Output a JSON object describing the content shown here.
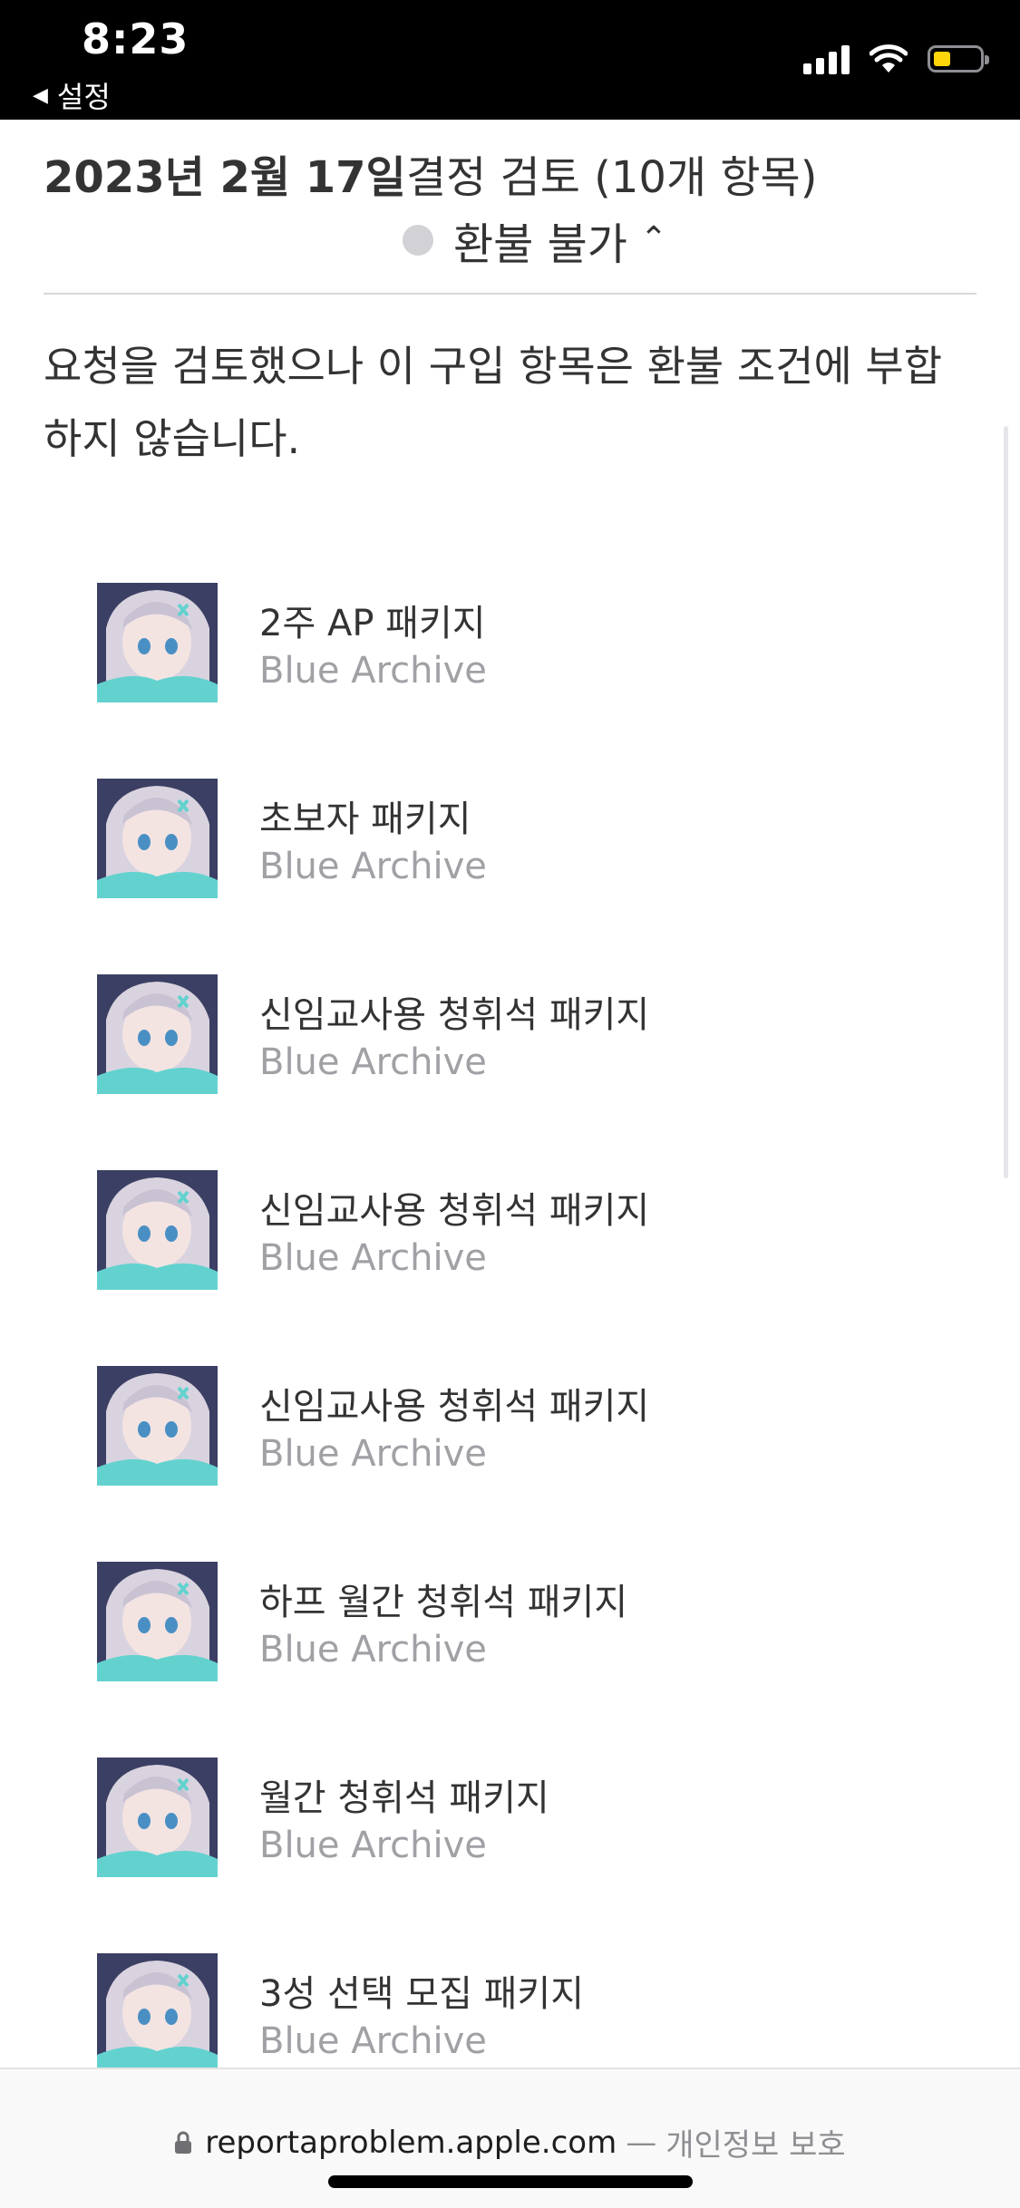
{
  "status_bar": {
    "time": "8:23",
    "back_label": "설정"
  },
  "header": {
    "date": "2023년 2월 17일",
    "review": "결정 검토 (10개 항목)",
    "status": "환불 불가"
  },
  "message": "요청을 검토했으나 이 구입 항목은 환불 조건에 부합하지 않습니다.",
  "items": [
    {
      "title": "2주 AP 패키지",
      "subtitle": "Blue Archive"
    },
    {
      "title": "초보자 패키지",
      "subtitle": "Blue Archive"
    },
    {
      "title": "신임교사용 청휘석 패키지",
      "subtitle": "Blue Archive"
    },
    {
      "title": "신임교사용 청휘석 패키지",
      "subtitle": "Blue Archive"
    },
    {
      "title": "신임교사용 청휘석 패키지",
      "subtitle": "Blue Archive"
    },
    {
      "title": "하프 월간 청휘석 패키지",
      "subtitle": "Blue Archive"
    },
    {
      "title": "월간 청휘석 패키지",
      "subtitle": "Blue Archive"
    },
    {
      "title": "3성 선택 모집 패키지",
      "subtitle": "Blue Archive"
    }
  ],
  "url_bar": {
    "domain": "reportaproblem.apple.com",
    "separator": "—",
    "privacy": "개인정보 보호"
  },
  "colors": {
    "status_bar_bg": "#000000",
    "status_dot": "#d1d1d6",
    "subtitle": "#a0a0a5",
    "battery": "#ffd60a"
  }
}
